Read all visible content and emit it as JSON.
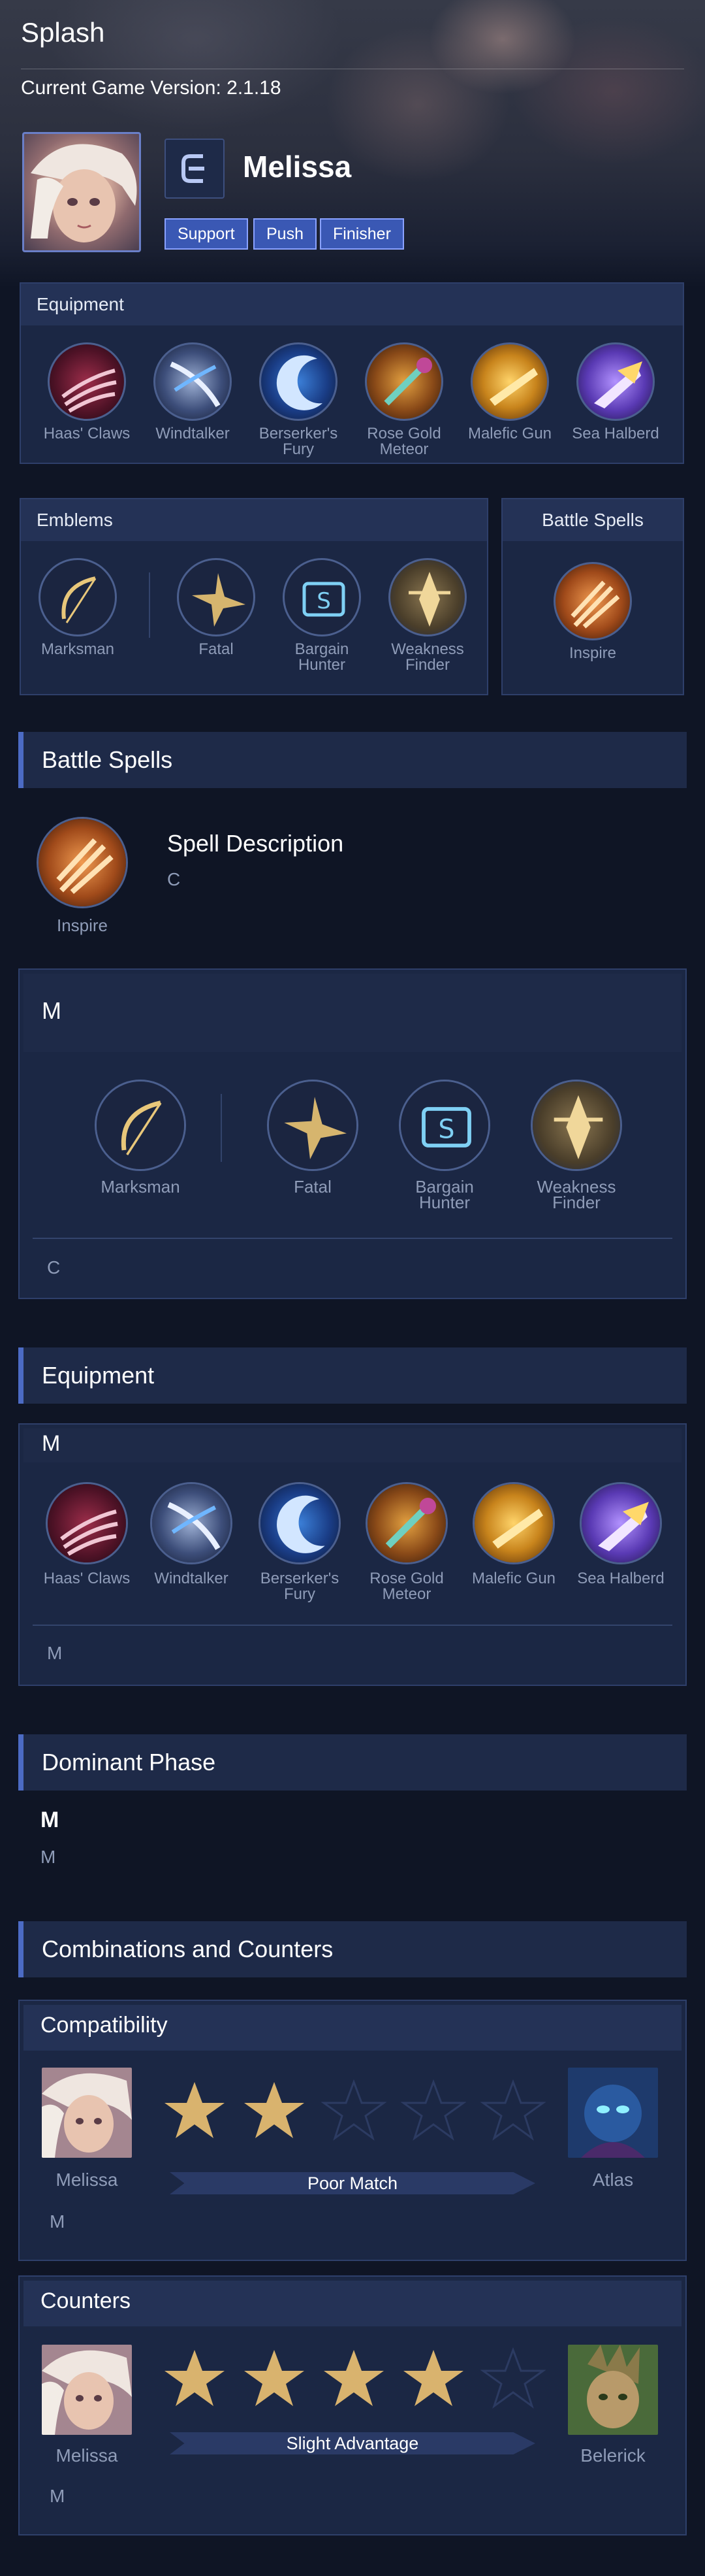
{
  "header": {
    "title": "Splash",
    "version": "Current Game Version: 2.1.18",
    "hero_name": "Melissa",
    "role_icon": "marksman-role-icon",
    "tags": [
      "Support",
      "Push",
      "Finisher"
    ]
  },
  "equipment_panel": {
    "title": "Equipment",
    "items": [
      {
        "label": "Haas' Claws",
        "icon": "haas-claws-icon"
      },
      {
        "label": "Windtalker",
        "icon": "windtalker-icon"
      },
      {
        "label": "Berserker's Fury",
        "icon": "berserkers-fury-icon"
      },
      {
        "label": "Rose Gold Meteor",
        "icon": "rose-gold-meteor-icon"
      },
      {
        "label": "Malefic Gun",
        "icon": "malefic-gun-icon"
      },
      {
        "label": "Sea Halberd",
        "icon": "sea-halberd-icon"
      }
    ]
  },
  "emblems_panel": {
    "title": "Emblems",
    "items": [
      {
        "label": "Marksman",
        "icon": "marksman-emblem-icon"
      },
      {
        "label": "Fatal",
        "icon": "fatal-talent-icon"
      },
      {
        "label": "Bargain Hunter",
        "icon": "bargain-hunter-talent-icon"
      },
      {
        "label": "Weakness Finder",
        "icon": "weakness-finder-talent-icon"
      }
    ]
  },
  "battle_spells_panel": {
    "title": "Battle Spells",
    "spell": {
      "label": "Inspire",
      "icon": "inspire-spell-icon"
    }
  },
  "battle_spells_section": {
    "heading": "Battle Spells",
    "spell_label": "Inspire",
    "description_title": "Spell Description",
    "description_text": "C"
  },
  "emblem_section": {
    "heading": "M",
    "items": [
      "Marksman",
      "Fatal",
      "Bargain Hunter",
      "Weakness Finder"
    ],
    "note": "C"
  },
  "equipment_section": {
    "heading": "Equipment",
    "sub_heading": "M",
    "items": [
      "Haas' Claws",
      "Windtalker",
      "Berserker's Fury",
      "Rose Gold Meteor",
      "Malefic Gun",
      "Sea Halberd"
    ],
    "note": "M"
  },
  "dominant_phase": {
    "heading": "Dominant Phase",
    "title": "M",
    "text": "M"
  },
  "combinations": {
    "heading": "Combinations and Counters",
    "compatibility": {
      "title": "Compatibility",
      "hero_left": "Melissa",
      "hero_right": "Atlas",
      "rating": 2,
      "max_rating": 5,
      "label": "Poor Match",
      "note": "M"
    },
    "counters": {
      "title": "Counters",
      "hero_left": "Melissa",
      "hero_right": "Belerick",
      "rating": 4,
      "max_rating": 5,
      "label": "Slight Advantage",
      "note": "M"
    }
  },
  "colors": {
    "background": "#0f1525",
    "panel": "#1b2744",
    "accent": "#4c6bc4",
    "tag": "#3a58b4",
    "star_gold": "#d9b36e",
    "muted_text": "#8f9cb8"
  }
}
